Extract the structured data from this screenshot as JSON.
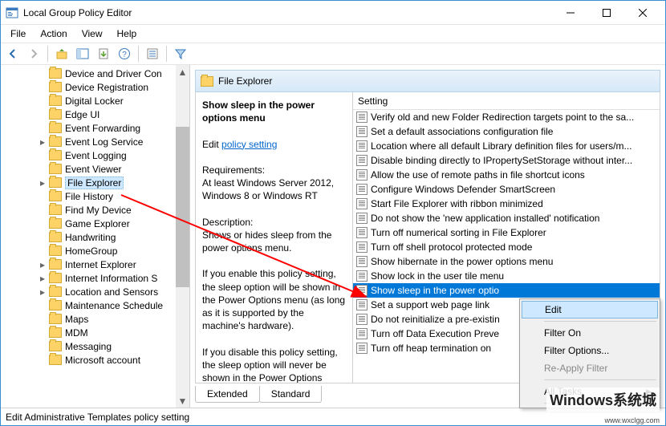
{
  "window": {
    "title": "Local Group Policy Editor"
  },
  "menubar": {
    "file": "File",
    "action": "Action",
    "view": "View",
    "help": "Help"
  },
  "tree": {
    "items": [
      {
        "label": "Device and Driver Con"
      },
      {
        "label": "Device Registration"
      },
      {
        "label": "Digital Locker"
      },
      {
        "label": "Edge UI"
      },
      {
        "label": "Event Forwarding"
      },
      {
        "label": "Event Log Service",
        "exp": ">"
      },
      {
        "label": "Event Logging"
      },
      {
        "label": "Event Viewer"
      },
      {
        "label": "File Explorer",
        "exp": ">",
        "sel": true
      },
      {
        "label": "File History"
      },
      {
        "label": "Find My Device"
      },
      {
        "label": "Game Explorer"
      },
      {
        "label": "Handwriting"
      },
      {
        "label": "HomeGroup"
      },
      {
        "label": "Internet Explorer",
        "exp": ">"
      },
      {
        "label": "Internet Information S",
        "exp": ">"
      },
      {
        "label": "Location and Sensors",
        "exp": ">"
      },
      {
        "label": "Maintenance Schedule"
      },
      {
        "label": "Maps"
      },
      {
        "label": "MDM"
      },
      {
        "label": "Messaging"
      },
      {
        "label": "Microsoft account"
      }
    ]
  },
  "header": {
    "title": "File Explorer"
  },
  "desc": {
    "title": "Show sleep in the power options menu",
    "edit_prefix": "Edit ",
    "edit_link": "policy setting ",
    "req_label": "Requirements:",
    "req_text": "At least Windows Server 2012, Windows 8 or Windows RT",
    "desc_label": "Description:",
    "desc_text": "Shows or hides sleep from the power options menu.",
    "para1": "If you enable this policy setting, the sleep option will be shown in the Power Options menu (as long as it is supported by the machine's hardware).",
    "para2": "If you disable this policy setting, the sleep option will never be shown in the Power Options menu."
  },
  "list": {
    "column": "Setting",
    "items": [
      "Verify old and new Folder Redirection targets point to the sa...",
      "Set a default associations configuration file",
      "Location where all default Library definition files for users/m...",
      "Disable binding directly to IPropertySetStorage without inter...",
      "Allow the use of remote paths in file shortcut icons",
      "Configure Windows Defender SmartScreen",
      "Start File Explorer with ribbon minimized",
      "Do not show the 'new application installed' notification",
      "Turn off numerical sorting in File Explorer",
      "Turn off shell protocol protected mode",
      "Show hibernate in the power options menu",
      "Show lock in the user tile menu",
      "Show sleep in the power optio",
      "Set a support web page link",
      "Do not reinitialize a pre-existin",
      "Turn off Data Execution Preve",
      "Turn off heap termination on"
    ],
    "selected_index": 12
  },
  "tabs": {
    "extended": "Extended",
    "standard": "Standard"
  },
  "statusbar": {
    "text": "Edit Administrative Templates policy setting"
  },
  "contextmenu": {
    "edit": "Edit",
    "filter_on": "Filter On",
    "filter_options": "Filter Options...",
    "reapply": "Re-Apply Filter",
    "all_tasks": "All Tasks"
  },
  "watermark": {
    "main": "Windows系统城",
    "sub": "www.wxclgg.com"
  }
}
